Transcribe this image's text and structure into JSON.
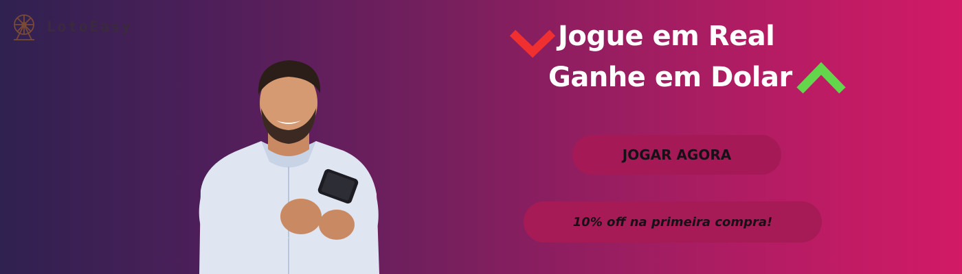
{
  "brand": {
    "name": "LotoEasy",
    "logo_icon": "ferris-wheel-icon"
  },
  "headline": {
    "line1": "Jogue em Real",
    "line2": "Ganhe em Dolar",
    "down_icon": "red-chevron-down-icon",
    "up_icon": "green-chevron-up-icon"
  },
  "cta": {
    "play_label": "JOGAR AGORA",
    "discount_label": "10% off na primeira compra!"
  },
  "colors": {
    "gradient_start": "#2f2150",
    "gradient_end": "#d21a66",
    "accent_red": "#f03030",
    "accent_green": "#63d64b",
    "button_bg": "#a51a56"
  }
}
